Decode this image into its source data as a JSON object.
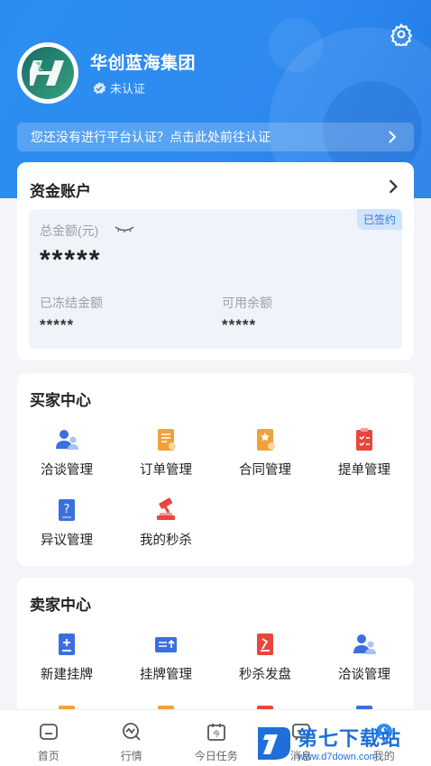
{
  "header": {
    "company_name": "华创蓝海集团",
    "verify_status": "未认证",
    "notice": "您还没有进行平台认证？点击此处前往认证"
  },
  "funds": {
    "title": "资金账户",
    "signed_badge": "已签约",
    "total_label": "总金额(元)",
    "total_value": "*****",
    "frozen_label": "已冻结金额",
    "frozen_value": "*****",
    "available_label": "可用余额",
    "available_value": "*****"
  },
  "buyer": {
    "title": "买家中心",
    "items": [
      {
        "label": "洽谈管理",
        "icon": "negotiation-icon"
      },
      {
        "label": "订单管理",
        "icon": "order-icon"
      },
      {
        "label": "合同管理",
        "icon": "contract-icon"
      },
      {
        "label": "提单管理",
        "icon": "bill-of-lading-icon"
      },
      {
        "label": "异议管理",
        "icon": "objection-icon"
      },
      {
        "label": "我的秒杀",
        "icon": "flash-sale-icon"
      }
    ]
  },
  "seller": {
    "title": "卖家中心",
    "items": [
      {
        "label": "新建挂牌",
        "icon": "new-listing-icon"
      },
      {
        "label": "挂牌管理",
        "icon": "listing-manage-icon"
      },
      {
        "label": "秒杀发盘",
        "icon": "flash-offer-icon"
      },
      {
        "label": "洽谈管理",
        "icon": "negotiation-icon"
      }
    ]
  },
  "tabbar": [
    {
      "label": "首页",
      "icon": "home-icon"
    },
    {
      "label": "行情",
      "icon": "market-icon"
    },
    {
      "label": "今日任务",
      "icon": "calendar-icon"
    },
    {
      "label": "消息",
      "icon": "message-icon"
    },
    {
      "label": "我的",
      "icon": "profile-icon"
    }
  ],
  "watermark": {
    "title": "第七下载站",
    "url": "www.d7down.com"
  },
  "colors": {
    "primary": "#2a8ef0",
    "badge_bg": "#cfe3fb",
    "icon_blue": "#3b6fe0",
    "icon_orange": "#f2a13a",
    "icon_red": "#e8463c"
  }
}
